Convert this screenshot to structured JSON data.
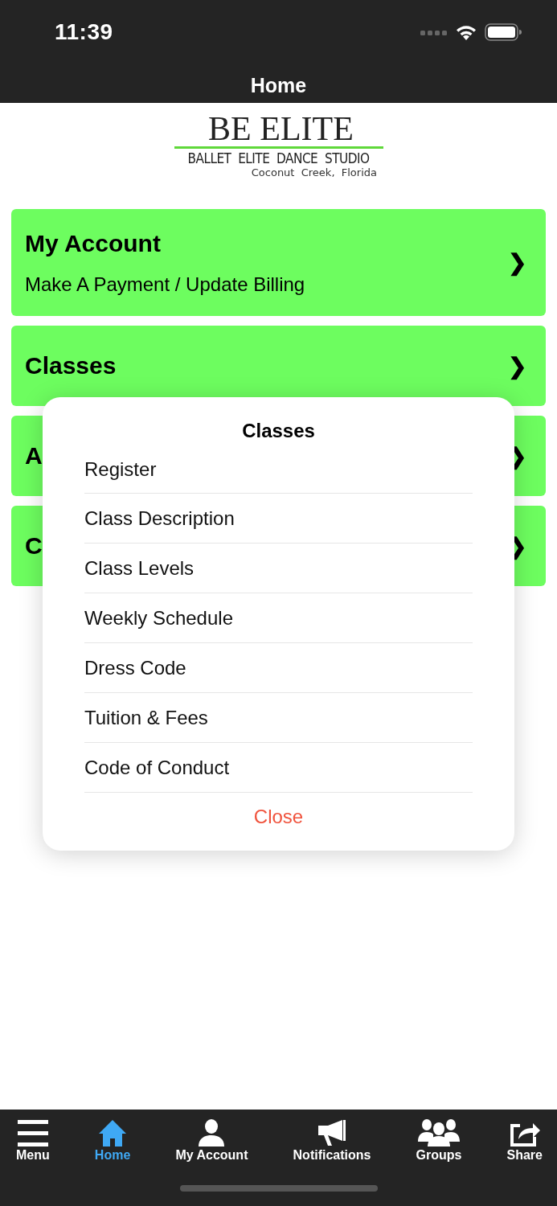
{
  "status_bar": {
    "time": "11:39"
  },
  "nav_bar": {
    "title": "Home"
  },
  "logo": {
    "name": "BE ELITE",
    "subtitle": "BALLET  ELITE  DANCE  STUDIO",
    "location": "Coconut  Creek,  Florida"
  },
  "cards": [
    {
      "title": "My Account",
      "subtitle": "Make A Payment / Update Billing",
      "chevron": "❯"
    },
    {
      "title": "Classes",
      "chevron": "❯"
    },
    {
      "title": "A",
      "chevron": "❯"
    },
    {
      "title": "C",
      "chevron": "❯"
    }
  ],
  "popup": {
    "title": "Classes",
    "items": [
      "Register",
      "Class Description",
      "Class Levels",
      "Weekly Schedule",
      "Dress Code",
      "Tuition & Fees",
      "Code of Conduct"
    ],
    "close": "Close"
  },
  "tab_bar": [
    {
      "kind": "menu",
      "label": "Menu",
      "selected": false
    },
    {
      "kind": "home",
      "label": "Home",
      "selected": true
    },
    {
      "kind": "account",
      "label": "My Account",
      "selected": false
    },
    {
      "kind": "notifications",
      "label": "Notifications",
      "selected": false
    },
    {
      "kind": "groups",
      "label": "Groups",
      "selected": false
    },
    {
      "kind": "share",
      "label": "Share",
      "selected": false
    }
  ]
}
